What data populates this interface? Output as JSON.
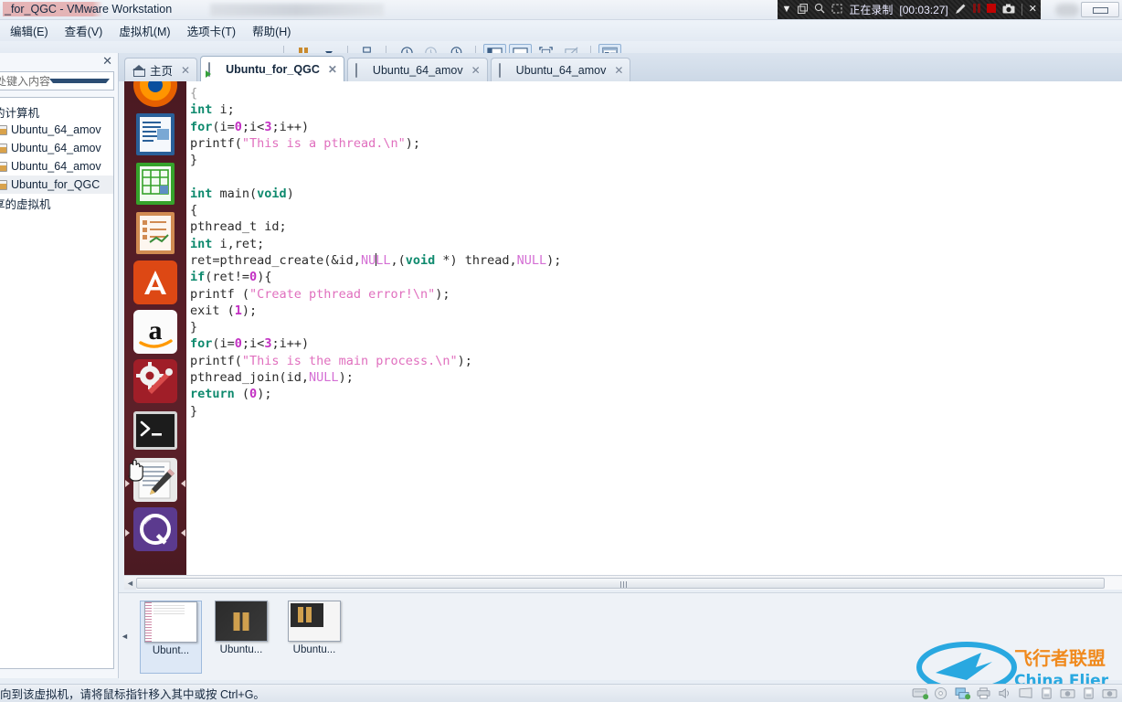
{
  "window": {
    "title": "_for_QGC - VMware Workstation",
    "minimize_label": "▭"
  },
  "recording": {
    "dropdown_icon": "▼",
    "restore_icon": "▣",
    "zoom_icon": "search-icon",
    "region_icon": "▣",
    "label": "正在录制",
    "time": "[00:03:27]",
    "pen_icon": "✎",
    "pause_icon": "❚❚",
    "stop_icon": "■",
    "camera_icon": "▣",
    "close_icon": "✕"
  },
  "menu": {
    "items": [
      {
        "label": "编辑(E)"
      },
      {
        "label": "查看(V)"
      },
      {
        "label": "虚拟机(M)"
      },
      {
        "label": "选项卡(T)"
      },
      {
        "label": "帮助(H)"
      }
    ]
  },
  "toolbar": {
    "pause_title": "暂停",
    "dropdown_title": "电源选项",
    "ctrlaltdel_title": "发送 Ctrl+Alt+Del",
    "snapshot_title": "拍摄快照",
    "revert_title": "恢复快照",
    "snapmgr_title": "快照管理器",
    "library_title": "显示或隐藏库",
    "console_title": "控制台视图",
    "fullscreen_title": "全屏",
    "unity_title": "Unity 模式",
    "prefs_title": "首选项"
  },
  "library": {
    "close_label": "✕",
    "search_placeholder": "处键入内容进行...",
    "search_caret": "▼",
    "items": [
      {
        "label": "的计算机",
        "type": "header",
        "selected": false
      },
      {
        "label": "Ubuntu_64_amov",
        "type": "vm",
        "selected": false
      },
      {
        "label": "Ubuntu_64_amov",
        "type": "vm",
        "selected": false
      },
      {
        "label": "Ubuntu_64_amov",
        "type": "vm",
        "selected": false
      },
      {
        "label": "Ubuntu_for_QGC",
        "type": "vm",
        "selected": true
      },
      {
        "label": "享的虚拟机",
        "type": "header",
        "selected": false
      }
    ]
  },
  "tabs": [
    {
      "label": "主页",
      "icon": "home-icon",
      "active": false,
      "close": "✕"
    },
    {
      "label": "Ubuntu_for_QGC",
      "icon": "vm-running-icon",
      "active": true,
      "close": "✕"
    },
    {
      "label": "Ubuntu_64_amov",
      "icon": "vm-suspended-icon",
      "active": false,
      "close": "✕"
    },
    {
      "label": "Ubuntu_64_amov",
      "icon": "vm-suspended-icon",
      "active": false,
      "close": "✕"
    }
  ],
  "launcher": {
    "items": [
      {
        "name": "firefox-icon",
        "label": "Firefox"
      },
      {
        "name": "libreoffice-writer-icon",
        "label": "LibreOffice Writer"
      },
      {
        "name": "libreoffice-calc-icon",
        "label": "LibreOffice Calc"
      },
      {
        "name": "libreoffice-impress-icon",
        "label": "LibreOffice Impress"
      },
      {
        "name": "ubuntu-software-icon",
        "label": "Ubuntu Software"
      },
      {
        "name": "amazon-icon",
        "label": "Amazon"
      },
      {
        "name": "system-settings-icon",
        "label": "System Settings"
      },
      {
        "name": "terminal-icon",
        "label": "Terminal"
      },
      {
        "name": "text-editor-icon",
        "label": "Text Editor"
      },
      {
        "name": "qgroundcontrol-icon",
        "label": "QGroundControl"
      }
    ]
  },
  "editor": {
    "language": "c",
    "cursor_line": "ret=pthread_create(&id,NULL,(void *) thread,NULL);",
    "code_lines": [
      "{",
      "int i;",
      "for(i=0;i<3;i++)",
      "printf(\"This is a pthread.\\n\");",
      "}",
      "",
      "int main(void)",
      "{",
      "pthread_t id;",
      "int i,ret;",
      "ret=pthread_create(&id,NULL,(void *) thread,NULL);",
      "if(ret!=0){",
      "printf (\"Create pthread error!\\n\");",
      "exit (1);",
      "}",
      "for(i=0;i<3;i++)",
      "printf(\"This is the main process.\\n\");",
      "pthread_join(id,NULL);",
      "return (0);",
      "}"
    ]
  },
  "scrollbar": {
    "left_arrow": "◄",
    "right_arrow": "►"
  },
  "thumbnails": {
    "collapse_icon": "◄",
    "items": [
      {
        "label": "Ubunt...",
        "style": "gedit",
        "selected": true
      },
      {
        "label": "Ubuntu...",
        "style": "dark",
        "selected": false
      },
      {
        "label": "Ubuntu...",
        "style": "mix",
        "selected": false
      }
    ]
  },
  "statusbar": {
    "message": "向到该虚拟机，请将鼠标指针移入其中或按 Ctrl+G。",
    "devices": [
      "hard-disk-icon",
      "cd-dvd-icon",
      "network-icon",
      "printer-icon",
      "sound-icon",
      "display-icon",
      "usb-icon",
      "camera-icon",
      "usb-icon",
      "camera-icon"
    ]
  },
  "watermark": {
    "text_cn": "飞行者联盟",
    "text_en": "China Flier"
  },
  "colors": {
    "accent": "#2c7fd0",
    "recording_red": "#cc0000",
    "ubuntu_aubergine": "#55202a",
    "string_pink": "#e06fbe",
    "keyword_green": "#0f8a6e",
    "number_magenta": "#c22fc2",
    "watermark_blue": "#29a8e0",
    "watermark_orange": "#f08a1e"
  }
}
